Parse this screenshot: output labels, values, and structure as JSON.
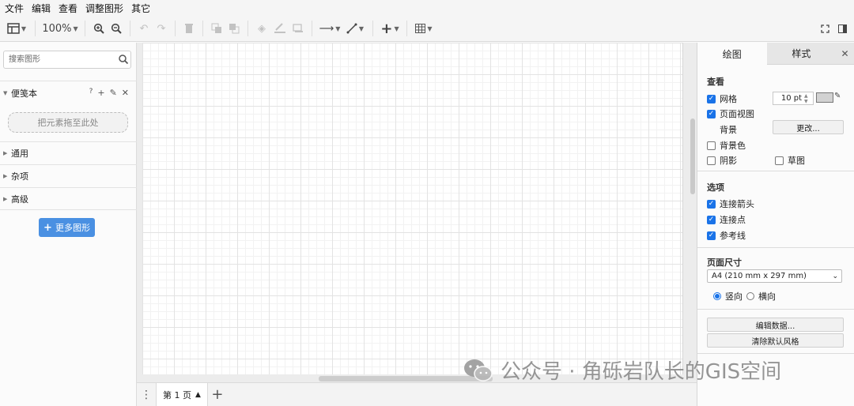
{
  "menu": [
    "文件",
    "编辑",
    "查看",
    "调整图形",
    "其它"
  ],
  "toolbar": {
    "zoom": "100%",
    "colors": {
      "icon": "#444444",
      "disabled": "#c2c2c2"
    }
  },
  "left": {
    "search_placeholder": "搜索图形",
    "scratchpad": {
      "title": "便笺本",
      "help": "?",
      "add": "+",
      "dropzone": "把元素拖至此处"
    },
    "sections": [
      "通用",
      "杂项",
      "高级"
    ],
    "more_shapes": "更多图形"
  },
  "pages": {
    "current": "第 1 页"
  },
  "right": {
    "tabs": [
      "绘图",
      "样式"
    ],
    "view": {
      "title": "查看",
      "grid": {
        "label": "网格",
        "checked": true,
        "size": "10 pt"
      },
      "page_view": {
        "label": "页面视图",
        "checked": true
      },
      "background": {
        "label": "背景",
        "button": "更改..."
      },
      "bg_color": {
        "label": "背景色",
        "checked": false
      },
      "shadow": {
        "label": "阴影",
        "checked": false
      },
      "sketch": {
        "label": "草图",
        "checked": false
      }
    },
    "options": {
      "title": "选项",
      "items": [
        {
          "label": "连接箭头",
          "checked": true
        },
        {
          "label": "连接点",
          "checked": true
        },
        {
          "label": "参考线",
          "checked": true
        }
      ]
    },
    "page_size": {
      "title": "页面尺寸",
      "selected": "A4 (210 mm x 297 mm)",
      "portrait": "竖向",
      "landscape": "横向",
      "orientation": "portrait"
    },
    "buttons": {
      "edit_data": "编辑数据...",
      "clear_style": "清除默认风格"
    }
  },
  "watermark": "公众号 · 角砾岩队长的GIS空间",
  "colors": {
    "accent": "#1a73e8",
    "more_button": "#4a90e2"
  }
}
